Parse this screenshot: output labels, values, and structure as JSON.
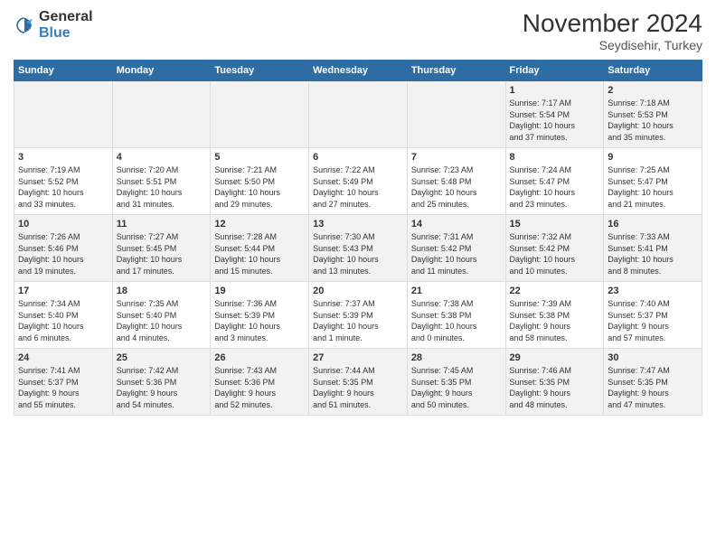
{
  "logo": {
    "general": "General",
    "blue": "Blue"
  },
  "title": "November 2024",
  "subtitle": "Seydisehir, Turkey",
  "days_of_week": [
    "Sunday",
    "Monday",
    "Tuesday",
    "Wednesday",
    "Thursday",
    "Friday",
    "Saturday"
  ],
  "weeks": [
    [
      {
        "day": "",
        "info": ""
      },
      {
        "day": "",
        "info": ""
      },
      {
        "day": "",
        "info": ""
      },
      {
        "day": "",
        "info": ""
      },
      {
        "day": "",
        "info": ""
      },
      {
        "day": "1",
        "info": "Sunrise: 7:17 AM\nSunset: 5:54 PM\nDaylight: 10 hours\nand 37 minutes."
      },
      {
        "day": "2",
        "info": "Sunrise: 7:18 AM\nSunset: 5:53 PM\nDaylight: 10 hours\nand 35 minutes."
      }
    ],
    [
      {
        "day": "3",
        "info": "Sunrise: 7:19 AM\nSunset: 5:52 PM\nDaylight: 10 hours\nand 33 minutes."
      },
      {
        "day": "4",
        "info": "Sunrise: 7:20 AM\nSunset: 5:51 PM\nDaylight: 10 hours\nand 31 minutes."
      },
      {
        "day": "5",
        "info": "Sunrise: 7:21 AM\nSunset: 5:50 PM\nDaylight: 10 hours\nand 29 minutes."
      },
      {
        "day": "6",
        "info": "Sunrise: 7:22 AM\nSunset: 5:49 PM\nDaylight: 10 hours\nand 27 minutes."
      },
      {
        "day": "7",
        "info": "Sunrise: 7:23 AM\nSunset: 5:48 PM\nDaylight: 10 hours\nand 25 minutes."
      },
      {
        "day": "8",
        "info": "Sunrise: 7:24 AM\nSunset: 5:47 PM\nDaylight: 10 hours\nand 23 minutes."
      },
      {
        "day": "9",
        "info": "Sunrise: 7:25 AM\nSunset: 5:47 PM\nDaylight: 10 hours\nand 21 minutes."
      }
    ],
    [
      {
        "day": "10",
        "info": "Sunrise: 7:26 AM\nSunset: 5:46 PM\nDaylight: 10 hours\nand 19 minutes."
      },
      {
        "day": "11",
        "info": "Sunrise: 7:27 AM\nSunset: 5:45 PM\nDaylight: 10 hours\nand 17 minutes."
      },
      {
        "day": "12",
        "info": "Sunrise: 7:28 AM\nSunset: 5:44 PM\nDaylight: 10 hours\nand 15 minutes."
      },
      {
        "day": "13",
        "info": "Sunrise: 7:30 AM\nSunset: 5:43 PM\nDaylight: 10 hours\nand 13 minutes."
      },
      {
        "day": "14",
        "info": "Sunrise: 7:31 AM\nSunset: 5:42 PM\nDaylight: 10 hours\nand 11 minutes."
      },
      {
        "day": "15",
        "info": "Sunrise: 7:32 AM\nSunset: 5:42 PM\nDaylight: 10 hours\nand 10 minutes."
      },
      {
        "day": "16",
        "info": "Sunrise: 7:33 AM\nSunset: 5:41 PM\nDaylight: 10 hours\nand 8 minutes."
      }
    ],
    [
      {
        "day": "17",
        "info": "Sunrise: 7:34 AM\nSunset: 5:40 PM\nDaylight: 10 hours\nand 6 minutes."
      },
      {
        "day": "18",
        "info": "Sunrise: 7:35 AM\nSunset: 5:40 PM\nDaylight: 10 hours\nand 4 minutes."
      },
      {
        "day": "19",
        "info": "Sunrise: 7:36 AM\nSunset: 5:39 PM\nDaylight: 10 hours\nand 3 minutes."
      },
      {
        "day": "20",
        "info": "Sunrise: 7:37 AM\nSunset: 5:39 PM\nDaylight: 10 hours\nand 1 minute."
      },
      {
        "day": "21",
        "info": "Sunrise: 7:38 AM\nSunset: 5:38 PM\nDaylight: 10 hours\nand 0 minutes."
      },
      {
        "day": "22",
        "info": "Sunrise: 7:39 AM\nSunset: 5:38 PM\nDaylight: 9 hours\nand 58 minutes."
      },
      {
        "day": "23",
        "info": "Sunrise: 7:40 AM\nSunset: 5:37 PM\nDaylight: 9 hours\nand 57 minutes."
      }
    ],
    [
      {
        "day": "24",
        "info": "Sunrise: 7:41 AM\nSunset: 5:37 PM\nDaylight: 9 hours\nand 55 minutes."
      },
      {
        "day": "25",
        "info": "Sunrise: 7:42 AM\nSunset: 5:36 PM\nDaylight: 9 hours\nand 54 minutes."
      },
      {
        "day": "26",
        "info": "Sunrise: 7:43 AM\nSunset: 5:36 PM\nDaylight: 9 hours\nand 52 minutes."
      },
      {
        "day": "27",
        "info": "Sunrise: 7:44 AM\nSunset: 5:35 PM\nDaylight: 9 hours\nand 51 minutes."
      },
      {
        "day": "28",
        "info": "Sunrise: 7:45 AM\nSunset: 5:35 PM\nDaylight: 9 hours\nand 50 minutes."
      },
      {
        "day": "29",
        "info": "Sunrise: 7:46 AM\nSunset: 5:35 PM\nDaylight: 9 hours\nand 48 minutes."
      },
      {
        "day": "30",
        "info": "Sunrise: 7:47 AM\nSunset: 5:35 PM\nDaylight: 9 hours\nand 47 minutes."
      }
    ]
  ]
}
